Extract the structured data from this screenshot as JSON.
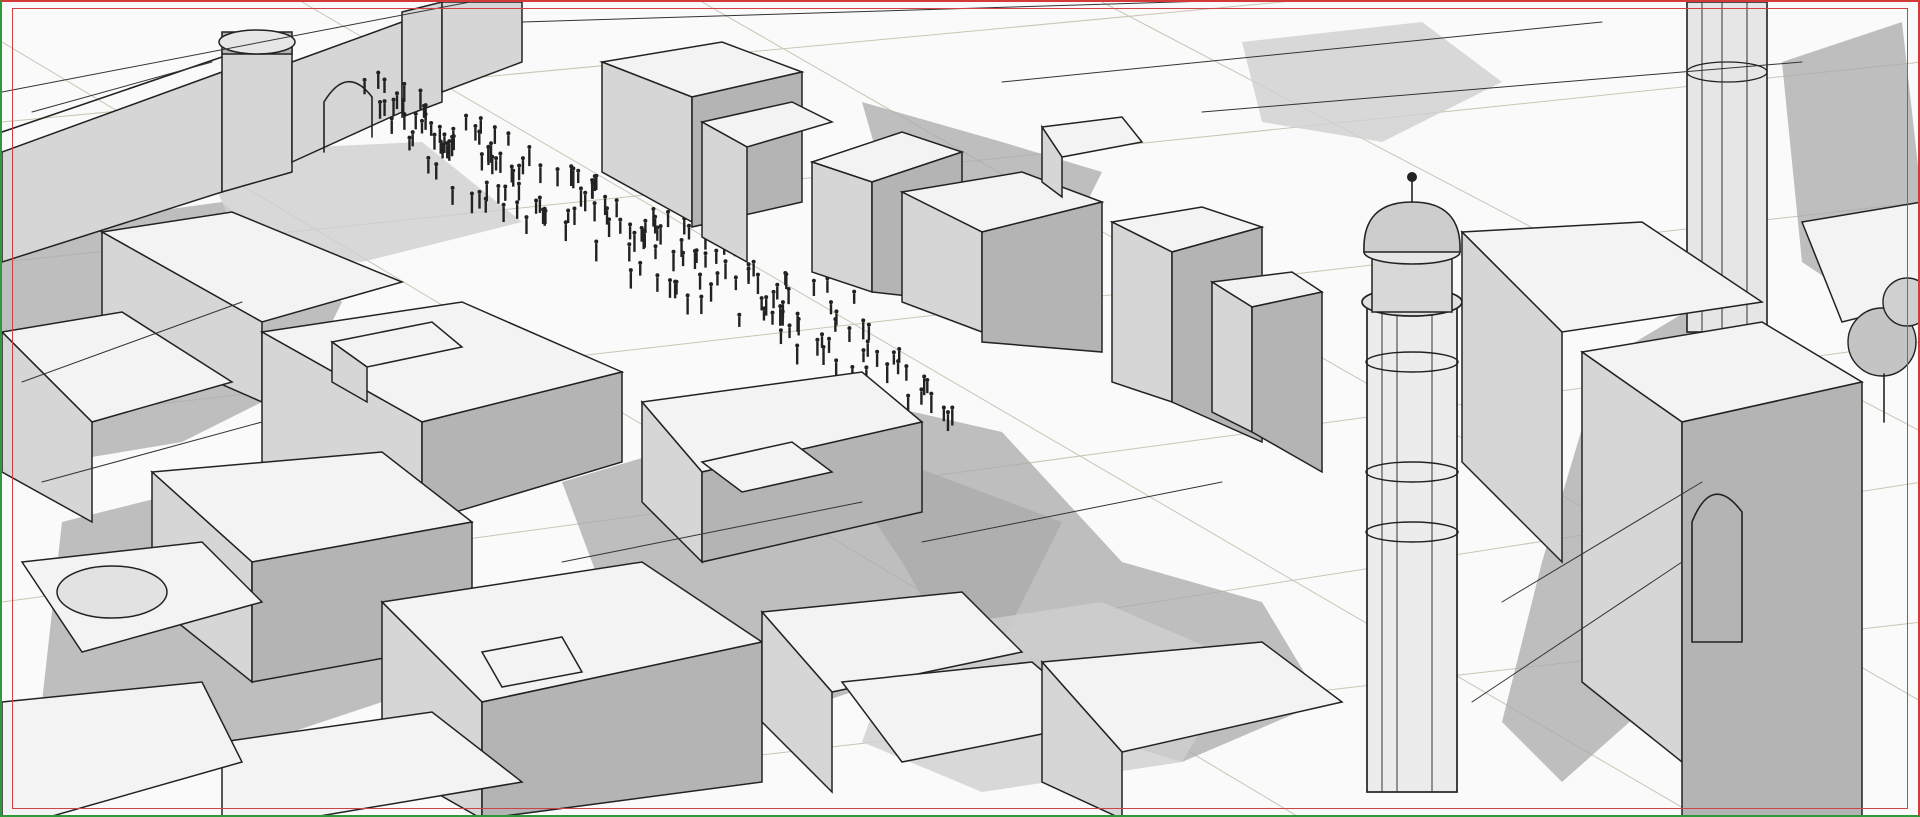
{
  "scene": {
    "style": "grayscale pencil storyboard sketch",
    "frame_colors": {
      "top_right_border": "#d33a3a",
      "bottom_left_border": "#2f9a3a",
      "paper": "#fafafa",
      "ink": "#222222",
      "shadow": "#a9a9a9",
      "perspective_guides": "#c9c6b3"
    },
    "icons": [
      "city-gate-icon",
      "minaret-icon",
      "crowd-icon",
      "tower-icon",
      "tree-icon"
    ]
  }
}
